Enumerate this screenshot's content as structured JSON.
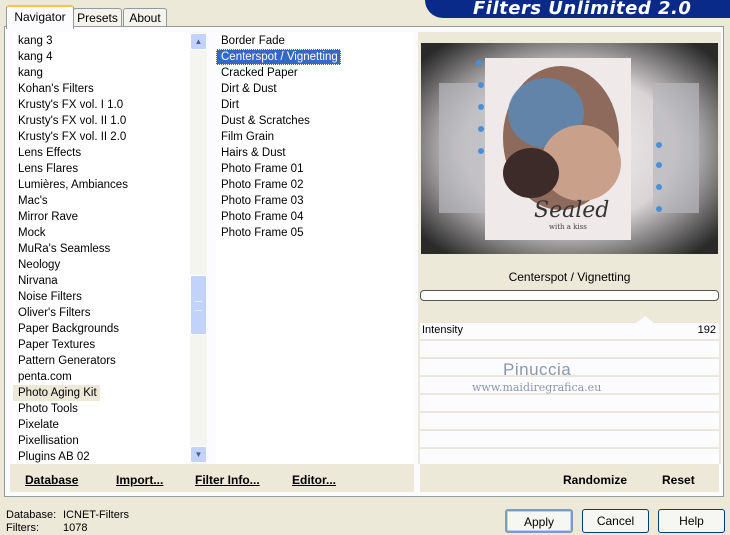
{
  "tabs": [
    "Navigator",
    "Presets",
    "About"
  ],
  "banner_title": "Filters Unlimited 2.0",
  "categories": [
    "kang 3",
    "kang 4",
    "kang",
    "Kohan's Filters",
    "Krusty's FX vol. I 1.0",
    "Krusty's FX vol. II 1.0",
    "Krusty's FX vol. II 2.0",
    "Lens Effects",
    "Lens Flares",
    "Lumières, Ambiances",
    "Mac's",
    "Mirror Rave",
    "Mock",
    "MuRa's Seamless",
    "Neology",
    "Nirvana",
    "Noise Filters",
    "Oliver's Filters",
    "Paper Backgrounds",
    "Paper Textures",
    "Pattern Generators",
    "penta.com",
    "Photo Aging Kit",
    "Photo Tools",
    "Pixelate",
    "Pixellisation",
    "Plugins AB 02"
  ],
  "selected_category": "Photo Aging Kit",
  "filters": [
    "Border Fade",
    "Centerspot / Vignetting",
    "Cracked Paper",
    "Dirt & Dust",
    "Dirt",
    "Dust & Scratches",
    "Film Grain",
    "Hairs & Dust",
    "Photo Frame 01",
    "Photo Frame 02",
    "Photo Frame 03",
    "Photo Frame 04",
    "Photo Frame 05"
  ],
  "selected_filter": "Centerspot / Vignetting",
  "bottom_left_buttons": {
    "database": "Database",
    "import": "Import...",
    "filter_info": "Filter Info...",
    "editor": "Editor..."
  },
  "bottom_right_buttons": {
    "randomize": "Randomize",
    "reset": "Reset"
  },
  "current_filter_name": "Centerspot / Vignetting",
  "preview_text": {
    "title": "Sealed",
    "subtitle": "with a kiss"
  },
  "params": [
    {
      "label": "Intensity",
      "value": "192"
    }
  ],
  "watermark": {
    "line1": "Pinuccia",
    "line2": "www.maidiregrafica.eu"
  },
  "status": {
    "database_label": "Database:",
    "database_value": "ICNET-Filters",
    "filters_label": "Filters:",
    "filters_value": "1078"
  },
  "dialog_buttons": {
    "apply": "Apply",
    "cancel": "Cancel",
    "help": "Help"
  },
  "scroll_icons": {
    "up": "scroll-up-arrow",
    "down": "scroll-down-arrow"
  }
}
